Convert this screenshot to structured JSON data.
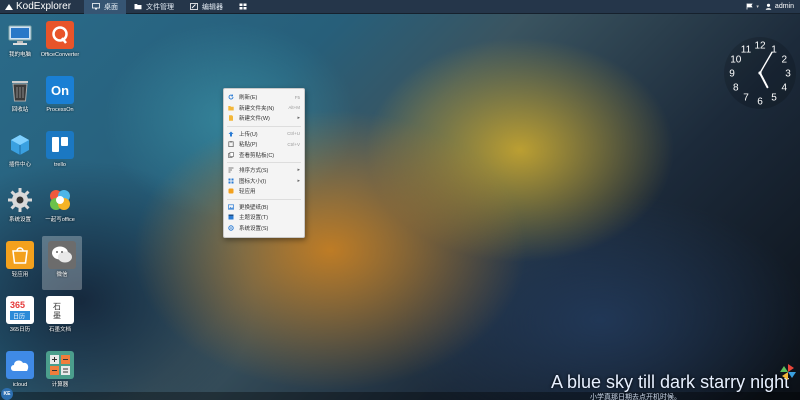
{
  "topbar": {
    "brand": "KodExplorer",
    "tabs": [
      {
        "label": "桌面",
        "icon": "monitor-icon",
        "active": true
      },
      {
        "label": "文件管理",
        "icon": "folder-icon",
        "active": false
      },
      {
        "label": "编辑器",
        "icon": "edit-icon",
        "active": false
      },
      {
        "label": "",
        "icon": "grid-icon",
        "active": false
      }
    ],
    "user": "admin"
  },
  "desktop_icons": [
    {
      "label": "我的电脑",
      "icon": "computer-icon",
      "bg": "#1d6fb8"
    },
    {
      "label": "OfficeConverter",
      "icon": "office-converter-icon",
      "bg": "#e8542a"
    },
    {
      "label": "回收站",
      "icon": "recycle-bin-icon",
      "bg": "transparent"
    },
    {
      "label": "ProcessOn",
      "icon": "processon-icon",
      "bg": "#1a7fd4"
    },
    {
      "label": "插件中心",
      "icon": "plugin-center-icon",
      "bg": "transparent"
    },
    {
      "label": "trello",
      "icon": "trello-icon",
      "bg": "#1b78c2"
    },
    {
      "label": "系统设置",
      "icon": "settings-gear-icon",
      "bg": "transparent"
    },
    {
      "label": "一起写office",
      "icon": "yiqixie-icon",
      "bg": "transparent"
    },
    {
      "label": "轻应用",
      "icon": "app-store-icon",
      "bg": "#f3a11d"
    },
    {
      "label": "微信",
      "icon": "wechat-icon",
      "bg": "#6c6c6c"
    },
    {
      "label": "365日历",
      "icon": "calendar-icon",
      "bg": "#ffffff"
    },
    {
      "label": "石墨文档",
      "icon": "shimo-icon",
      "bg": "#ffffff"
    },
    {
      "label": "icloud",
      "icon": "icloud-icon",
      "bg": "#3f8ae6"
    },
    {
      "label": "计算器",
      "icon": "calculator-icon",
      "bg": "#4b9e8c"
    }
  ],
  "context_menu": {
    "items": [
      {
        "label": "刷新(E)",
        "icon": "refresh-icon",
        "key": "F5",
        "arrow": false
      },
      {
        "label": "新建文件夹(N)",
        "icon": "new-folder-icon",
        "key": "Alt+M",
        "arrow": false
      },
      {
        "label": "新建文件(W)",
        "icon": "new-file-icon",
        "key": "",
        "arrow": true
      },
      {
        "sep": true
      },
      {
        "label": "上传(U)",
        "icon": "upload-icon",
        "key": "Ctrl+U",
        "arrow": false
      },
      {
        "label": "粘贴(P)",
        "icon": "paste-icon",
        "key": "Ctrl+V",
        "arrow": false
      },
      {
        "label": "查看剪贴板(C)",
        "icon": "clipboard-icon",
        "key": "",
        "arrow": false
      },
      {
        "sep": true
      },
      {
        "label": "排序方式(S)",
        "icon": "sort-icon",
        "key": "",
        "arrow": true
      },
      {
        "label": "图标大小(I)",
        "icon": "icon-size-icon",
        "key": "",
        "arrow": true
      },
      {
        "label": "轻应用",
        "icon": "light-app-icon",
        "key": "",
        "arrow": false
      },
      {
        "sep": true
      },
      {
        "label": "更换壁纸(B)",
        "icon": "wallpaper-icon",
        "key": "",
        "arrow": false
      },
      {
        "label": "主题设置(T)",
        "icon": "theme-icon",
        "key": "",
        "arrow": false
      },
      {
        "label": "系统设置(S)",
        "icon": "system-settings-icon",
        "key": "",
        "arrow": false
      }
    ]
  },
  "clock": {
    "numerals": [
      "12",
      "1",
      "2",
      "3",
      "4",
      "5",
      "6",
      "7",
      "8",
      "9",
      "10",
      "11"
    ],
    "time": {
      "hour": 5,
      "minute": 5
    }
  },
  "caption": {
    "text": "A blue sky till dark starry night",
    "sub": "小学真那日期去点开机时候。"
  },
  "start_button": "KE",
  "colors": {
    "accent": "#25364a",
    "active_tab": "#365573"
  }
}
